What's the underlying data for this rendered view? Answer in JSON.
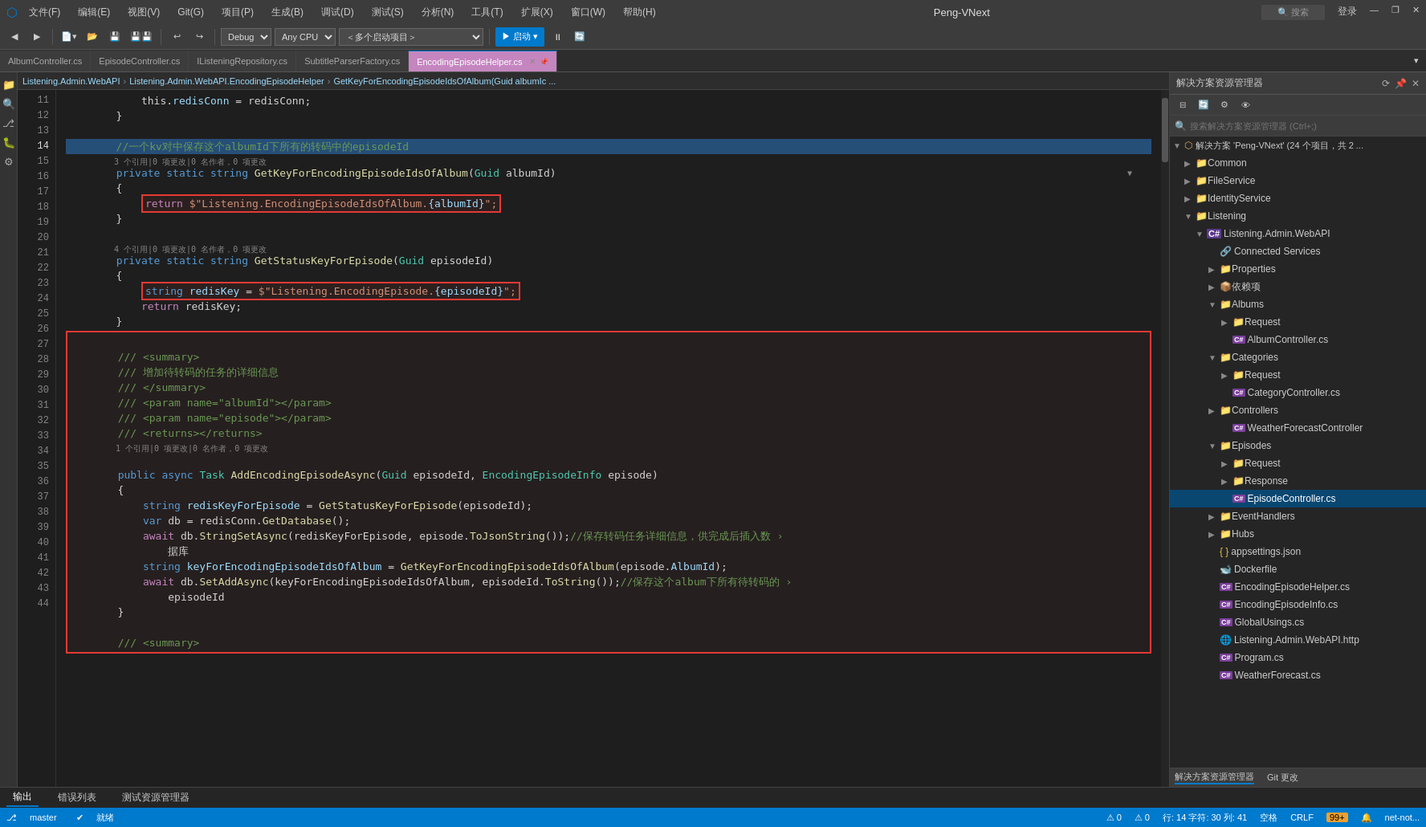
{
  "titlebar": {
    "logo": "⬡",
    "title": "Peng-VNext",
    "minimize": "—",
    "restore": "❐",
    "close": "✕",
    "search_placeholder": "搜索",
    "signin": "登录"
  },
  "menubar": {
    "items": [
      "文件(F)",
      "编辑(E)",
      "视图(V)",
      "Git(G)",
      "项目(P)",
      "生成(B)",
      "调试(D)",
      "测试(S)",
      "分析(N)",
      "工具(T)",
      "扩展(X)",
      "窗口(W)",
      "帮助(H)"
    ]
  },
  "toolbar": {
    "debug_mode": "Debug",
    "platform": "Any CPU",
    "startup": "＜多个启动项目＞",
    "start": "▶ 启动 ▾"
  },
  "tabs": [
    {
      "label": "AlbumController.cs",
      "active": false
    },
    {
      "label": "EpisodeController.cs",
      "active": false
    },
    {
      "label": "IListeningRepository.cs",
      "active": false
    },
    {
      "label": "SubtitleParserFactory.cs",
      "active": false
    },
    {
      "label": "EncodingEpisodeHelper.cs",
      "active": true
    }
  ],
  "subnav": {
    "breadcrumb1": "Listening.Admin.WebAPI",
    "breadcrumb2": "Listening.Admin.WebAPI.EncodingEpisodeHelper",
    "breadcrumb3": "GetKeyForEncodingEpisodeIdsOfAlbum(Guid albumIc ..."
  },
  "code": {
    "lines": [
      {
        "num": 11,
        "content": "            this.redisConn = redisConn;",
        "type": "plain"
      },
      {
        "num": 12,
        "content": "        }",
        "type": "plain"
      },
      {
        "num": 13,
        "content": "",
        "type": "plain"
      },
      {
        "num": 14,
        "content": "        //一个kv对中保存这个albumId下所有的转码中的episodeId",
        "type": "comment",
        "annotation": "3 个引用|0 项更改|0 名作者，0 项更改"
      },
      {
        "num": 15,
        "content": "        private static string GetKeyForEncodingEpisodeIdsOfAlbum(Guid albumId)",
        "type": "code"
      },
      {
        "num": 16,
        "content": "        {",
        "type": "plain"
      },
      {
        "num": 17,
        "content": "            return $\"Listening.EncodingEpisodeIdsOfAlbum.{albumId}\";",
        "type": "code",
        "redbox": true
      },
      {
        "num": 18,
        "content": "        }",
        "type": "plain"
      },
      {
        "num": 19,
        "content": "",
        "type": "plain",
        "annotation": "4 个引用|0 项更改|0 名作者，0 项更改"
      },
      {
        "num": 20,
        "content": "        private static string GetStatusKeyForEpisode(Guid episodeId)",
        "type": "code"
      },
      {
        "num": 21,
        "content": "        {",
        "type": "plain"
      },
      {
        "num": 22,
        "content": "            string redisKey = $\"Listening.EncodingEpisode.{episodeId}\";",
        "type": "code",
        "redbox": true
      },
      {
        "num": 23,
        "content": "            return redisKey;",
        "type": "plain"
      },
      {
        "num": 24,
        "content": "        }",
        "type": "plain"
      },
      {
        "num": 25,
        "content": "",
        "type": "plain"
      },
      {
        "num": 26,
        "content": "        /// <summary>",
        "type": "comment"
      },
      {
        "num": 27,
        "content": "        /// 增加待转码的任务的详细信息",
        "type": "comment"
      },
      {
        "num": 28,
        "content": "        /// </summary>",
        "type": "comment"
      },
      {
        "num": 29,
        "content": "        /// <param name=\"albumId\"></param>",
        "type": "comment"
      },
      {
        "num": 30,
        "content": "        /// <param name=\"episode\"></param>",
        "type": "comment"
      },
      {
        "num": 31,
        "content": "        /// <returns></returns>",
        "type": "comment"
      },
      {
        "num": 32,
        "content": "",
        "type": "plain",
        "annotation": "1 个引用|0 项更改|0 名作者，0 项更改"
      },
      {
        "num": 33,
        "content": "        public async Task AddEncodingEpisodeAsync(Guid episodeId, EncodingEpisodeInfo episode)",
        "type": "code"
      },
      {
        "num": 34,
        "content": "        {",
        "type": "plain"
      },
      {
        "num": 35,
        "content": "            string redisKeyForEpisode = GetStatusKeyForEpisode(episodeId);",
        "type": "code"
      },
      {
        "num": 36,
        "content": "            var db = redisConn.GetDatabase();",
        "type": "code"
      },
      {
        "num": 37,
        "content": "            await db.StringSetAsync(redisKeyForEpisode, episode.ToJsonString());//保存转码任务详细信息，供完成后插入数",
        "type": "code"
      },
      {
        "num": 38,
        "content": "                据库",
        "type": "plain"
      },
      {
        "num": 39,
        "content": "            string keyForEncodingEpisodeIdsOfAlbum = GetKeyForEncodingEpisodeIdsOfAlbum(episode.AlbumId);",
        "type": "code"
      },
      {
        "num": 40,
        "content": "            await db.SetAddAsync(keyForEncodingEpisodeIdsOfAlbum, episodeId.ToString());//保存这个album下所有待转码的",
        "type": "code"
      },
      {
        "num": 41,
        "content": "                episodeId",
        "type": "plain"
      },
      {
        "num": 42,
        "content": "        }",
        "type": "plain"
      },
      {
        "num": 43,
        "content": "",
        "type": "plain"
      },
      {
        "num": 44,
        "content": "        /// <summary>",
        "type": "comment"
      }
    ]
  },
  "solution_explorer": {
    "title": "解决方案资源管理器",
    "search_placeholder": "搜索解决方案资源管理器 (Ctrl+;)",
    "solution_label": "解决方案 'Peng-VNext' (24 个项目，共 2 ...",
    "tree": [
      {
        "indent": 0,
        "arrow": "▶",
        "icon": "folder",
        "label": "Common"
      },
      {
        "indent": 0,
        "arrow": "▶",
        "icon": "folder",
        "label": "FileService"
      },
      {
        "indent": 0,
        "arrow": "▶",
        "icon": "folder",
        "label": "IdentityService"
      },
      {
        "indent": 0,
        "arrow": "▼",
        "icon": "folder",
        "label": "Listening"
      },
      {
        "indent": 1,
        "arrow": "▼",
        "icon": "project",
        "label": "Listening.Admin.WebAPI"
      },
      {
        "indent": 2,
        "arrow": "",
        "icon": "connected",
        "label": "Connected Services"
      },
      {
        "indent": 2,
        "arrow": "▶",
        "icon": "folder",
        "label": "Properties"
      },
      {
        "indent": 2,
        "arrow": "▶",
        "icon": "folder",
        "label": "依赖项"
      },
      {
        "indent": 2,
        "arrow": "▼",
        "icon": "folder",
        "label": "Albums"
      },
      {
        "indent": 3,
        "arrow": "▶",
        "icon": "folder",
        "label": "Request"
      },
      {
        "indent": 3,
        "arrow": "",
        "icon": "cs",
        "label": "AlbumController.cs"
      },
      {
        "indent": 2,
        "arrow": "▼",
        "icon": "folder",
        "label": "Categories"
      },
      {
        "indent": 3,
        "arrow": "▶",
        "icon": "folder",
        "label": "Request"
      },
      {
        "indent": 3,
        "arrow": "",
        "icon": "cs",
        "label": "CategoryController.cs"
      },
      {
        "indent": 2,
        "arrow": "▶",
        "icon": "folder",
        "label": "Controllers"
      },
      {
        "indent": 3,
        "arrow": "",
        "icon": "cs",
        "label": "WeatherForecastController"
      },
      {
        "indent": 2,
        "arrow": "▼",
        "icon": "folder",
        "label": "Episodes"
      },
      {
        "indent": 3,
        "arrow": "▶",
        "icon": "folder",
        "label": "Request"
      },
      {
        "indent": 3,
        "arrow": "▶",
        "icon": "folder",
        "label": "Response"
      },
      {
        "indent": 3,
        "arrow": "",
        "icon": "cs",
        "label": "EpisodeController.cs",
        "selected": true
      },
      {
        "indent": 2,
        "arrow": "▶",
        "icon": "folder",
        "label": "EventHandlers"
      },
      {
        "indent": 2,
        "arrow": "▶",
        "icon": "folder",
        "label": "Hubs"
      },
      {
        "indent": 2,
        "arrow": "",
        "icon": "json",
        "label": "appsettings.json"
      },
      {
        "indent": 2,
        "arrow": "",
        "icon": "docker",
        "label": "Dockerfile"
      },
      {
        "indent": 2,
        "arrow": "",
        "icon": "cs",
        "label": "EncodingEpisodeHelper.cs"
      },
      {
        "indent": 2,
        "arrow": "",
        "icon": "cs",
        "label": "EncodingEpisodeInfo.cs"
      },
      {
        "indent": 2,
        "arrow": "",
        "icon": "cs",
        "label": "GlobalUsings.cs"
      },
      {
        "indent": 2,
        "arrow": "",
        "icon": "http",
        "label": "Listening.Admin.WebAPI.http"
      },
      {
        "indent": 2,
        "arrow": "",
        "icon": "cs",
        "label": "Program.cs"
      },
      {
        "indent": 2,
        "arrow": "",
        "icon": "cs",
        "label": "WeatherForecast.cs"
      }
    ]
  },
  "statusbar": {
    "git_icon": "⎇",
    "branch": "master",
    "status": "就绪",
    "errors": "0",
    "warnings": "0",
    "row": "行: 14",
    "col": "字符: 30",
    "char_col": "列: 41",
    "spaces": "空格",
    "encoding": "CRLF",
    "net_label": "net-not...",
    "plus_count": "99+",
    "notifications": "🔔"
  },
  "outputbar": {
    "tabs": [
      "输出",
      "错误列表",
      "测试资源管理器"
    ]
  }
}
